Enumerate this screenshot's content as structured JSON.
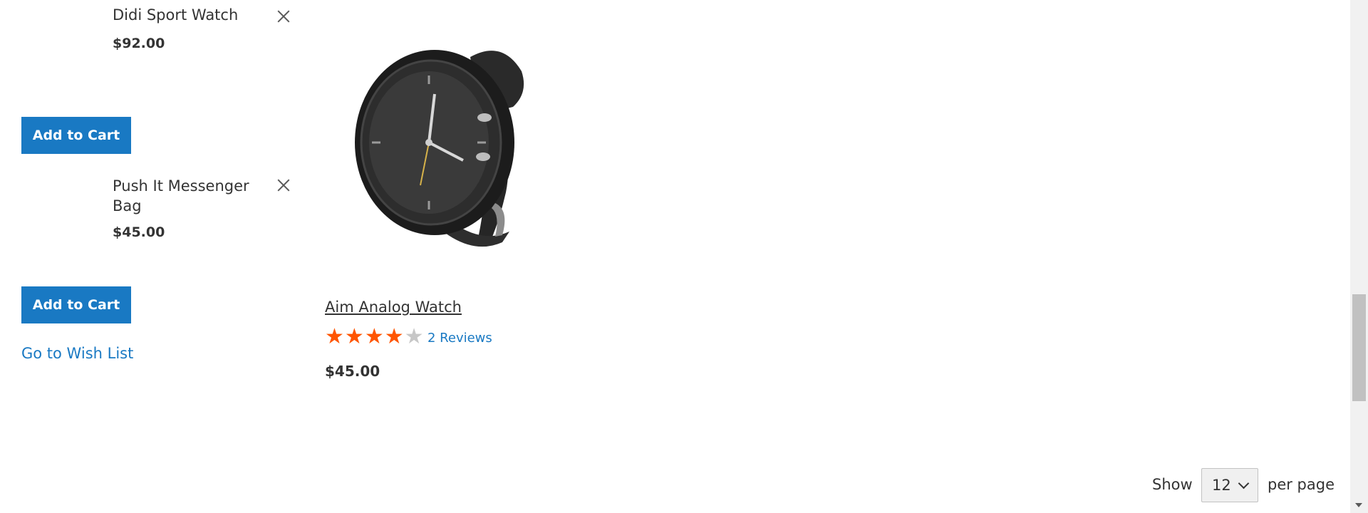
{
  "wishlist_sidebar": {
    "items": [
      {
        "name": "Didi Sport Watch",
        "price": "$92.00",
        "add_to_cart_label": "Add to Cart"
      },
      {
        "name": "Push It Messenger Bag",
        "price": "$45.00",
        "add_to_cart_label": "Add to Cart"
      }
    ],
    "go_to_wishlist_label": "Go to Wish List"
  },
  "product": {
    "name": "Aim Analog Watch",
    "rating_stars": 4,
    "rating_max": 5,
    "reviews_label": "2 Reviews",
    "price": "$45.00",
    "image_icon": "watch-image"
  },
  "toolbar": {
    "show_label": "Show",
    "limit_value": "12",
    "per_page_label": "per page"
  },
  "colors": {
    "accent": "#1979c3",
    "star_on": "#ff5501",
    "star_off": "#c7c7c7",
    "text": "#333333"
  }
}
